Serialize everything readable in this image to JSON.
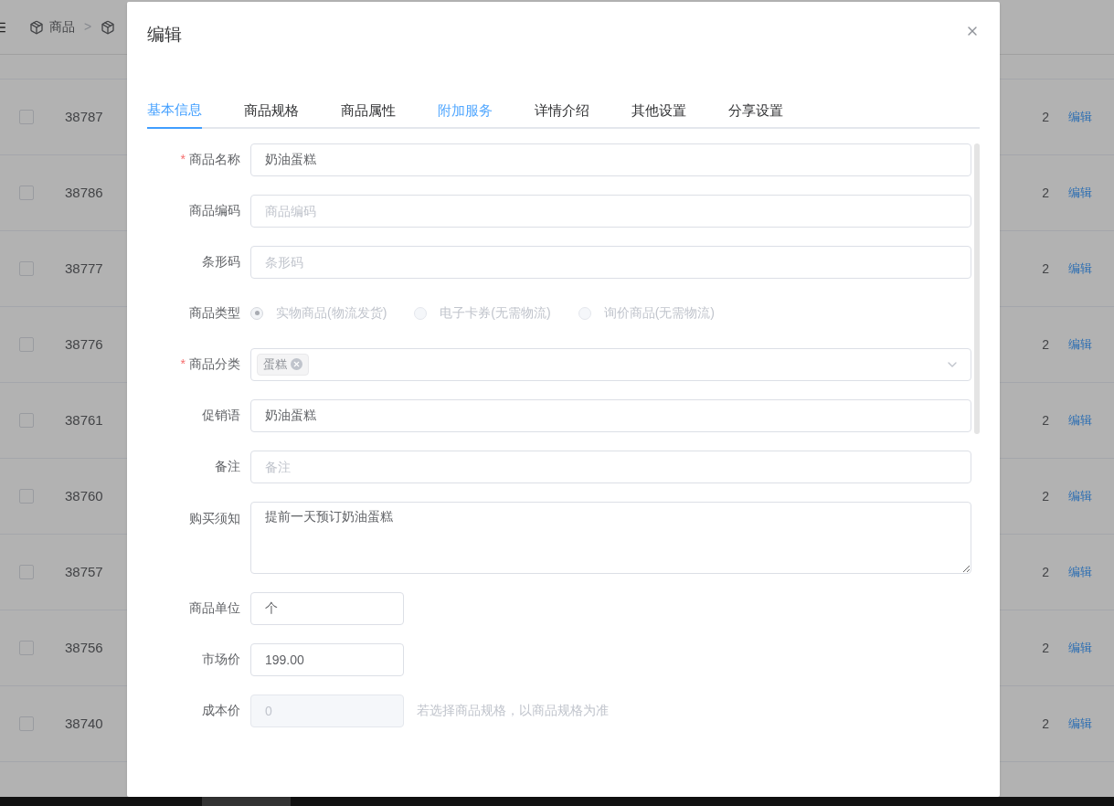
{
  "breadcrumb": {
    "items": [
      "商品"
    ],
    "separator": ">"
  },
  "table": {
    "rows": [
      {
        "checked": false,
        "id": "38787",
        "column_3": "2",
        "action": "编辑"
      },
      {
        "checked": false,
        "id": "38786",
        "column_3": "2",
        "action": "编辑"
      },
      {
        "checked": false,
        "id": "38777",
        "column_3": "2",
        "action": "编辑"
      },
      {
        "checked": false,
        "id": "38776",
        "column_3": "2",
        "action": "编辑"
      },
      {
        "checked": false,
        "id": "38761",
        "column_3": "2",
        "action": "编辑"
      },
      {
        "checked": false,
        "id": "38760",
        "column_3": "2",
        "action": "编辑"
      },
      {
        "checked": false,
        "id": "38757",
        "column_3": "2",
        "action": "编辑"
      },
      {
        "checked": false,
        "id": "38756",
        "column_3": "2",
        "action": "编辑"
      },
      {
        "checked": false,
        "id": "38740",
        "column_3": "2",
        "action": "编辑"
      }
    ]
  },
  "dialog": {
    "title": "编辑",
    "required_marker": "*",
    "tabs": [
      {
        "label": "基本信息",
        "selected": true,
        "highlighted": false
      },
      {
        "label": "商品规格",
        "selected": false,
        "highlighted": false
      },
      {
        "label": "商品属性",
        "selected": false,
        "highlighted": false
      },
      {
        "label": "附加服务",
        "selected": false,
        "highlighted": true
      },
      {
        "label": "详情介绍",
        "selected": false,
        "highlighted": false
      },
      {
        "label": "其他设置",
        "selected": false,
        "highlighted": false
      },
      {
        "label": "分享设置",
        "selected": false,
        "highlighted": false
      }
    ],
    "fields": [
      {
        "kind": "text",
        "label": "商品名称",
        "required": true,
        "value": "奶油蛋糕"
      },
      {
        "kind": "text",
        "label": "商品编码",
        "required": false,
        "placeholder": "商品编码"
      },
      {
        "kind": "text",
        "label": "条形码",
        "required": false,
        "placeholder": "条形码"
      },
      {
        "kind": "radio",
        "label": "商品类型",
        "required": false,
        "disabled": true,
        "options": [
          {
            "label": "实物商品(物流发货)",
            "selected": true
          },
          {
            "label": "电子卡券(无需物流)",
            "selected": false
          },
          {
            "label": "询价商品(无需物流)",
            "selected": false
          }
        ]
      },
      {
        "kind": "select",
        "label": "商品分类",
        "required": true,
        "tags": [
          "蛋糕"
        ]
      },
      {
        "kind": "text",
        "label": "促销语",
        "required": false,
        "value": "奶油蛋糕"
      },
      {
        "kind": "text",
        "label": "备注",
        "required": false,
        "placeholder": "备注"
      },
      {
        "kind": "textarea",
        "label": "购买须知",
        "required": false,
        "value": "提前一天预订奶油蛋糕"
      },
      {
        "kind": "short",
        "label": "商品单位",
        "required": false,
        "disabled": false,
        "value": "个"
      },
      {
        "kind": "short",
        "label": "市场价",
        "required": false,
        "disabled": false,
        "value": "199.00"
      },
      {
        "kind": "short",
        "label": "成本价",
        "required": false,
        "disabled": true,
        "value": "0",
        "hint": "若选择商品规格，以商品规格为准"
      }
    ]
  }
}
